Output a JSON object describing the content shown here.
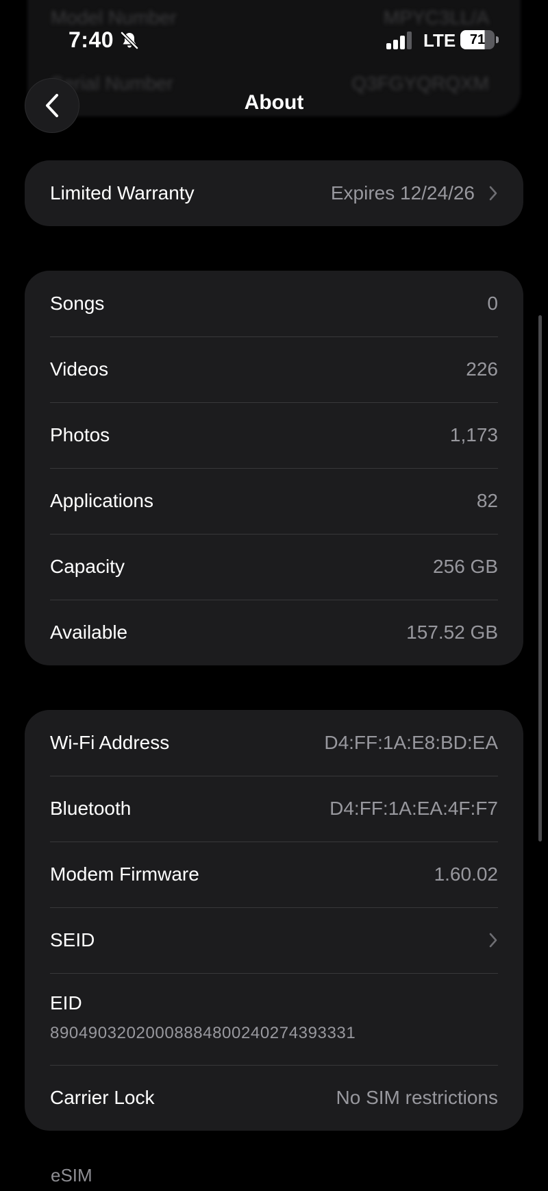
{
  "background_rows": [
    {
      "label": "Model Number",
      "value": "MPYC3LL/A"
    },
    {
      "label": "Serial Number",
      "value": "Q3FGYQRQXM"
    }
  ],
  "status_bar": {
    "time": "7:40",
    "network": "LTE",
    "battery": "71",
    "battery_fraction": 0.71,
    "silent_icon": "bell-slash-icon"
  },
  "nav": {
    "title": "About",
    "back_icon": "chevron-left-icon"
  },
  "warranty": {
    "label": "Limited Warranty",
    "value": "Expires 12/24/26"
  },
  "media": [
    {
      "label": "Songs",
      "value": "0"
    },
    {
      "label": "Videos",
      "value": "226"
    },
    {
      "label": "Photos",
      "value": "1,173"
    },
    {
      "label": "Applications",
      "value": "82"
    },
    {
      "label": "Capacity",
      "value": "256 GB"
    },
    {
      "label": "Available",
      "value": "157.52 GB"
    }
  ],
  "network_info": [
    {
      "label": "Wi-Fi Address",
      "value": "D4:FF:1A:E8:BD:EA"
    },
    {
      "label": "Bluetooth",
      "value": "D4:FF:1A:EA:4F:F7"
    },
    {
      "label": "Modem Firmware",
      "value": "1.60.02"
    },
    {
      "label": "SEID",
      "value": ""
    },
    {
      "label": "EID",
      "value": "89049032020008884800240274393331"
    },
    {
      "label": "Carrier Lock",
      "value": "No SIM restrictions"
    }
  ],
  "section_esim": "eSIM",
  "colors": {
    "background": "#000000",
    "card": "#1c1c1e",
    "separator": "#38383a",
    "secondary_text": "#98989e"
  }
}
